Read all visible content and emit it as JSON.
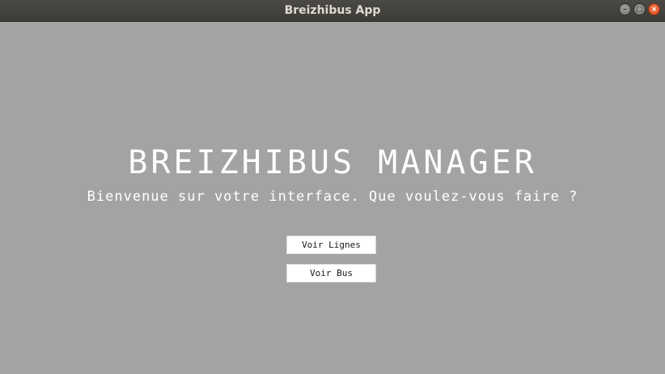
{
  "window": {
    "title": "Breizhibus App",
    "controls": {
      "minimize_icon": "minimize-icon",
      "maximize_icon": "maximize-icon",
      "close_icon": "close-icon"
    }
  },
  "main": {
    "heading": "BREIZHIBUS MANAGER",
    "subtitle": "Bienvenue sur votre interface. Que voulez-vous faire ?",
    "buttons": {
      "voir_lignes": "Voir Lignes",
      "voir_bus": "Voir Bus"
    }
  },
  "colors": {
    "background": "#a3a3a3",
    "titlebar": "#3c3b37",
    "close_button": "#e95420",
    "text": "#ffffff"
  }
}
